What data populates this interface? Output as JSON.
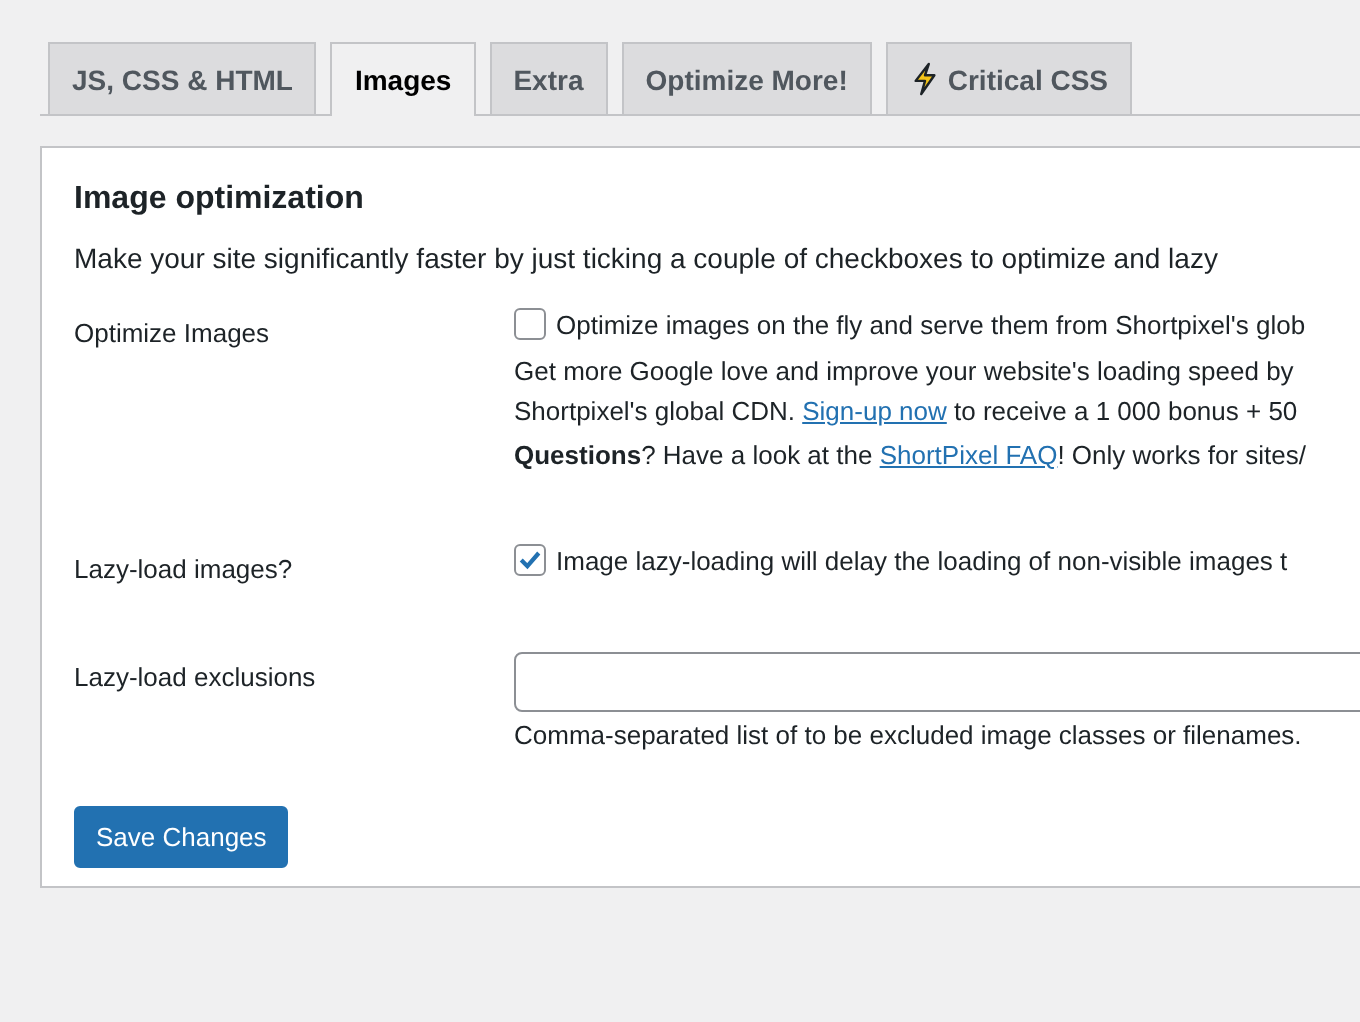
{
  "tabs": [
    {
      "label": "JS, CSS & HTML",
      "selected": false,
      "kind": "plain"
    },
    {
      "label": "Images",
      "selected": true,
      "kind": "plain"
    },
    {
      "label": "Extra",
      "selected": false,
      "kind": "plain"
    },
    {
      "label": "Optimize More!",
      "selected": false,
      "kind": "plain"
    },
    {
      "label": "Critical CSS",
      "selected": false,
      "kind": "bolt"
    }
  ],
  "section": {
    "title": "Image optimization",
    "intro": "Make your site significantly faster by just ticking a couple of checkboxes to optimize and lazy",
    "rows": [
      {
        "kind": "checkbox",
        "label": "Optimize Images",
        "checked": false,
        "text": "Optimize images on the fly and serve them from Shortpixel's glob",
        "notes": [
          {
            "lines": [
              {
                "before": "Get more Google love and improve your website's loading speed by"
              },
              {
                "before": "Shortpixel's global CDN. ",
                "link": "Sign-up now",
                "after": " to receive a 1 000 bonus + 50"
              }
            ]
          },
          {
            "lines": [
              {
                "before": "**Questions**? Have a look at the ",
                "link": "ShortPixel FAQ",
                "after": "! Only works for sites/"
              }
            ]
          }
        ]
      },
      {
        "kind": "checkbox",
        "label": "Lazy-load images?",
        "checked": true,
        "text": "Image lazy-loading will delay the loading of non-visible images t"
      },
      {
        "kind": "input",
        "label": "Lazy-load exclusions",
        "value": "",
        "help": "Comma-separated list of to be excluded image classes or filenames."
      }
    ]
  },
  "save_button": "Save Changes"
}
